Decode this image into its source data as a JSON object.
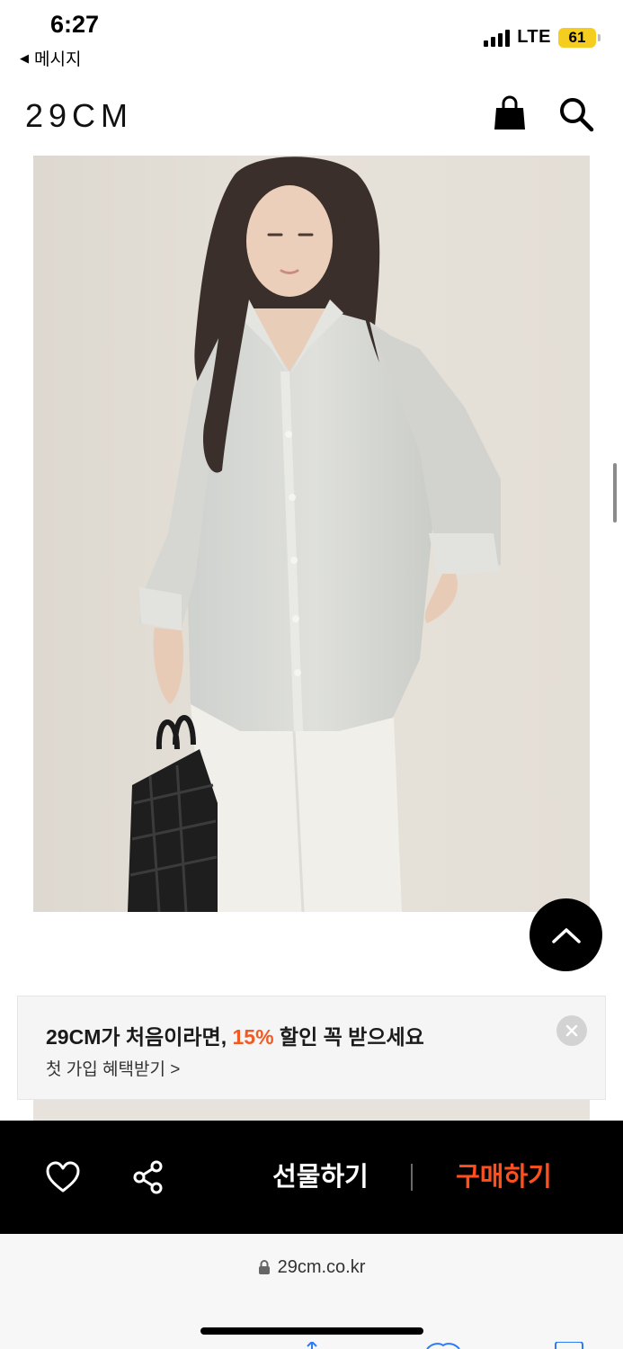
{
  "status_bar": {
    "time": "6:27",
    "back_label": "메시지",
    "network": "LTE",
    "battery": "61"
  },
  "header": {
    "logo": "29CM"
  },
  "promo": {
    "title_prefix": "29CM가 처음이라면, ",
    "discount": "15%",
    "title_suffix": " 할인 꼭 받으세요",
    "link": "첫 가입 혜택받기 >"
  },
  "actions": {
    "gift_label": "선물하기",
    "buy_label": "구매하기"
  },
  "browser": {
    "url": "29cm.co.kr"
  },
  "colors": {
    "accent": "#ff4f1f",
    "discount": "#f15a24",
    "action_bar": "#000000",
    "battery": "#f4cd1f"
  }
}
